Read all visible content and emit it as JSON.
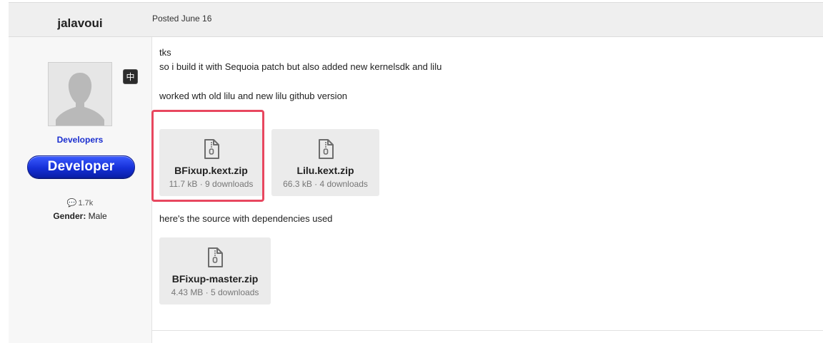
{
  "post": {
    "author": "jalavoui",
    "posted": "Posted June 16",
    "lines": [
      "tks",
      "so i build it with Sequoia patch but also added new kernelsdk and lilu",
      "worked wth old lilu and new lilu github version",
      "here's the source with dependencies used"
    ],
    "attachments": [
      {
        "name": "BFixup.kext.zip",
        "meta": "11.7 kB · 9 downloads"
      },
      {
        "name": "Lilu.kext.zip",
        "meta": "66.3 kB · 4 downloads"
      },
      {
        "name": "BFixup-master.zip",
        "meta": "4.43 MB · 5 downloads"
      }
    ]
  },
  "sidebar": {
    "language_badge": "中",
    "group": "Developers",
    "badge_label": "Developer",
    "post_count": "1.7k",
    "gender_label": "Gender:",
    "gender_value": "Male"
  },
  "colors": {
    "highlight": "#e8475f",
    "group_link": "#1a2ecf",
    "badge": "#1630d8"
  },
  "icons": {
    "attachment": "zip-file-icon",
    "posts": "comment-bubble-icon",
    "avatar": "default-avatar-icon"
  }
}
